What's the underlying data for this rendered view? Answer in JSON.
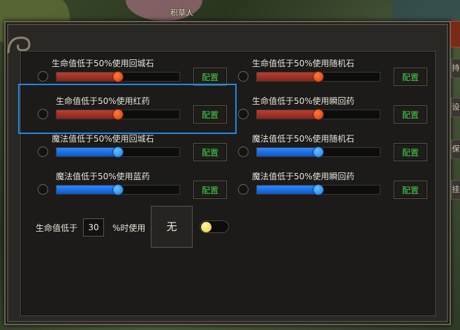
{
  "background": {
    "top_text": "积草人"
  },
  "rows_left": [
    {
      "label": "生命值低于50%使用回城石",
      "type": "red",
      "value_pct": 50,
      "button": "配置"
    },
    {
      "label": "生命值低于50%使用红药",
      "type": "red",
      "value_pct": 50,
      "button": "配置"
    },
    {
      "label": "魔法值低于50%使用回城石",
      "type": "blue",
      "value_pct": 50,
      "button": "配置"
    },
    {
      "label": "魔法值低于50%使用蓝药",
      "type": "blue",
      "value_pct": 50,
      "button": "配置"
    }
  ],
  "rows_right": [
    {
      "label": "生命值低于50%使用随机石",
      "type": "red",
      "value_pct": 50,
      "button": "配置"
    },
    {
      "label": "生命值低于50%使用瞬回药",
      "type": "red",
      "value_pct": 50,
      "button": "配置"
    },
    {
      "label": "魔法值低于50%使用随机石",
      "type": "blue",
      "value_pct": 50,
      "button": "配置"
    },
    {
      "label": "魔法值低于50%使用瞬回药",
      "type": "blue",
      "value_pct": 50,
      "button": "配置"
    }
  ],
  "bottom": {
    "prefix_label": "生命值低于",
    "threshold_value": "30",
    "suffix_label": "%时使用",
    "item_slot_text": "无",
    "toggle_on": false
  },
  "colors": {
    "accent_green": "#46d24a",
    "hp_red": "#b84035",
    "mp_blue": "#2a8aff",
    "highlight_blue": "#1e8ae6"
  }
}
